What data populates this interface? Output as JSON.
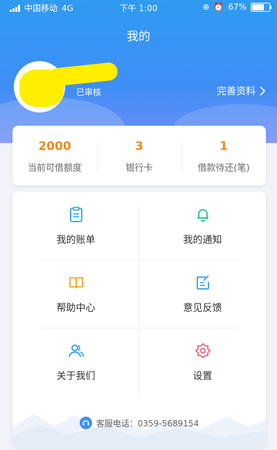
{
  "status_bar": {
    "carrier": "中国移动",
    "network": "4G",
    "time": "下午 1:00",
    "battery": "67%",
    "battery_level": 0.67
  },
  "header": {
    "title": "我的",
    "verified": "已审核",
    "complete_profile": "完善资料"
  },
  "stats": [
    {
      "value": "2000",
      "label": "当前可借额度"
    },
    {
      "value": "3",
      "label": "银行卡"
    },
    {
      "value": "1",
      "label": "借款待还(笔)"
    }
  ],
  "menu": [
    {
      "label": "我的账单",
      "icon": "bill-icon",
      "color": "#2f9bf2"
    },
    {
      "label": "我的通知",
      "icon": "bell-icon",
      "color": "#22c08a"
    },
    {
      "label": "帮助中心",
      "icon": "book-icon",
      "color": "#f5a623"
    },
    {
      "label": "意见反馈",
      "icon": "feedback-edit-icon",
      "color": "#2f9bf2"
    },
    {
      "label": "关于我们",
      "icon": "people-icon",
      "color": "#2f9bf2"
    },
    {
      "label": "设置",
      "icon": "gear-icon",
      "color": "#f0566a"
    }
  ],
  "footer": {
    "service_phone": "客服电话：0359-5689154"
  },
  "colors": {
    "header_blue": "#3f8ef6",
    "accent_orange": "#f08a1c"
  }
}
